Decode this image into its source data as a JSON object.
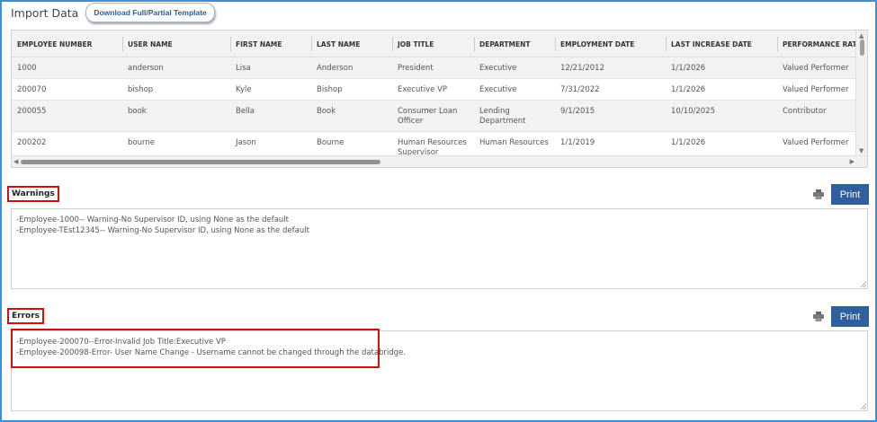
{
  "header": {
    "title": "Import Data",
    "template_button": "Download Full/Partial Template"
  },
  "grid": {
    "columns": [
      "EMPLOYEE NUMBER",
      "USER NAME",
      "FIRST NAME",
      "LAST NAME",
      "JOB TITLE",
      "DEPARTMENT",
      "EMPLOYMENT DATE",
      "LAST INCREASE DATE",
      "PERFORMANCE RATII"
    ],
    "rows": [
      [
        "1000",
        "anderson",
        "Lisa",
        "Anderson",
        "President",
        "Executive",
        "12/21/2012",
        "1/1/2026",
        "Valued Performer"
      ],
      [
        "200070",
        "bishop",
        "Kyle",
        "Bishop",
        "Executive VP",
        "Executive",
        "7/31/2022",
        "1/1/2026",
        "Valued Performer"
      ],
      [
        "200055",
        "book",
        "Bella",
        "Book",
        "Consumer Loan Officer",
        "Lending Department",
        "9/1/2015",
        "10/10/2025",
        "Contributor"
      ],
      [
        "200202",
        "bourne",
        "Jason",
        "Bourne",
        "Human Resources Supervisor",
        "Human Resources",
        "1/1/2019",
        "1/1/2026",
        "Valued Performer"
      ]
    ]
  },
  "warnings": {
    "label": "Warnings",
    "print_label": "Print",
    "lines": [
      "-Employee-1000-- Warning-No Supervisor ID, using None as the default",
      "-Employee-TEst12345-- Warning-No Supervisor ID, using None as the default"
    ]
  },
  "errors": {
    "label": "Errors",
    "print_label": "Print",
    "lines": [
      "-Employee-200070--Error-Invalid Job Title:Executive VP",
      "-Employee-200098-Error- User Name Change - Username cannot be changed through the databridge."
    ]
  },
  "icons": {
    "printer": "printer-icon",
    "scroll_left": "arrow-left-icon",
    "scroll_right": "arrow-right-icon",
    "scroll_up": "arrow-up-icon",
    "scroll_down": "arrow-down-icon"
  },
  "colors": {
    "frame_border": "#3d8fd8",
    "print_button": "#2f5f9e",
    "highlight": "#cc1111",
    "link_text": "#2d5d99"
  }
}
